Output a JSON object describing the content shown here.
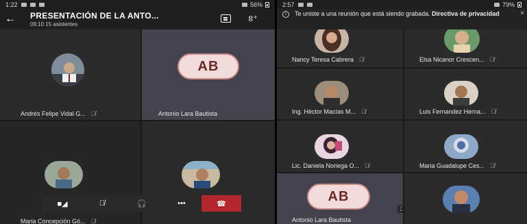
{
  "left_phone": {
    "status": {
      "time": "1:22",
      "battery": "56%"
    },
    "meeting": {
      "title": "PRESENTACIÓN DE LA ANTO...",
      "subtitle": "09:10  15 asistentes"
    },
    "tiles": [
      {
        "name": "Andrés Felipe Vidal G..."
      },
      {
        "name": "Antonio Lara Bautista",
        "initials": "AB"
      },
      {
        "name": "Maria Concepción Gó..."
      },
      {
        "name": ""
      }
    ],
    "callbar": {
      "camera": "■◢",
      "mic": "🎙̸",
      "audio": "🎧",
      "more": "•••",
      "hangup": "☎"
    }
  },
  "right_phone": {
    "status": {
      "time": "2:57",
      "battery": "79%"
    },
    "notice": {
      "text": "Te uniste a una reunión que está siendo grabada.",
      "link": "Directiva de privacidad",
      "close": "×"
    },
    "tiles": [
      {
        "name": "Nancy Teresa Cabrera"
      },
      {
        "name": "Elsa Nicanor Crescen..."
      },
      {
        "name": "Ing. Héctor Macías M..."
      },
      {
        "name": "Luis Fernandez Herna..."
      },
      {
        "name": "Lic. Daniela Noriega O..."
      },
      {
        "name": "Maria Guadalupe Ces..."
      },
      {
        "name": "Antonio Lara Bautista",
        "initials": "AB"
      },
      {
        "name": ""
      }
    ]
  },
  "icons": {
    "back": "←",
    "mic_off": "🎙̸",
    "people": "ខ⁺"
  }
}
